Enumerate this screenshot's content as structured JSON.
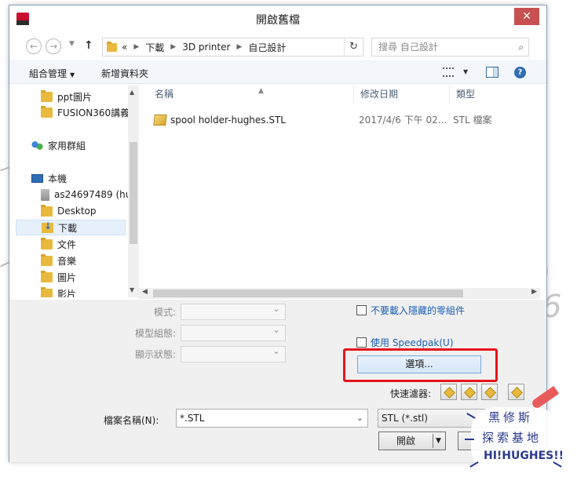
{
  "window": {
    "title": "開啟舊檔",
    "close_label": "✕"
  },
  "navbar": {
    "breadcrumb_prefix": "«",
    "breadcrumbs": [
      "下載",
      "3D printer",
      "自己設計"
    ],
    "search_placeholder": "搜尋 自己設計"
  },
  "toolbar": {
    "organize": "組合管理",
    "new_folder": "新增資料夾"
  },
  "nav_pane": {
    "items": [
      {
        "label": "ppt圖片",
        "icon": "folder-icon"
      },
      {
        "label": "FUSION360講義",
        "icon": "folder-icon"
      },
      {
        "label": "家用群組",
        "icon": "homegroup-icon"
      },
      {
        "label": "本機",
        "icon": "computer-icon"
      },
      {
        "label": "as24697489 (hu",
        "icon": "drive-icon"
      },
      {
        "label": "Desktop",
        "icon": "folder-icon"
      },
      {
        "label": "下載",
        "icon": "download-folder-icon",
        "selected": true
      },
      {
        "label": "文件",
        "icon": "folder-icon"
      },
      {
        "label": "音樂",
        "icon": "folder-icon"
      },
      {
        "label": "圖片",
        "icon": "folder-icon"
      },
      {
        "label": "影片",
        "icon": "folder-icon"
      }
    ]
  },
  "file_list": {
    "columns": [
      "名稱",
      "修改日期",
      "類型"
    ],
    "rows": [
      {
        "name": "spool holder-hughes.STL",
        "date": "2017/4/6 下午 02...",
        "type": "STL 檔案"
      }
    ]
  },
  "options": {
    "mode_label": "模式:",
    "config_label": "模型組態:",
    "display_state_label": "顯示狀態:",
    "no_hidden_label": "不要載入隱藏的零組件",
    "speedpak_label": "使用 Speedpak(U)",
    "options_button": "選項...",
    "filter_label": "快速濾器:"
  },
  "footer": {
    "filename_label": "檔案名稱(N):",
    "filename_value": "*.STL",
    "filetype_value": "STL (*.stl)",
    "open_label": "開啟"
  },
  "watermark": {
    "line1": "黑修斯",
    "line2": "探索基地",
    "line3": "HI!HUGHES!!"
  },
  "colors": {
    "close_bg": "#c75050",
    "highlight": "#e8141b",
    "link_blue": "#1b5fb5"
  }
}
